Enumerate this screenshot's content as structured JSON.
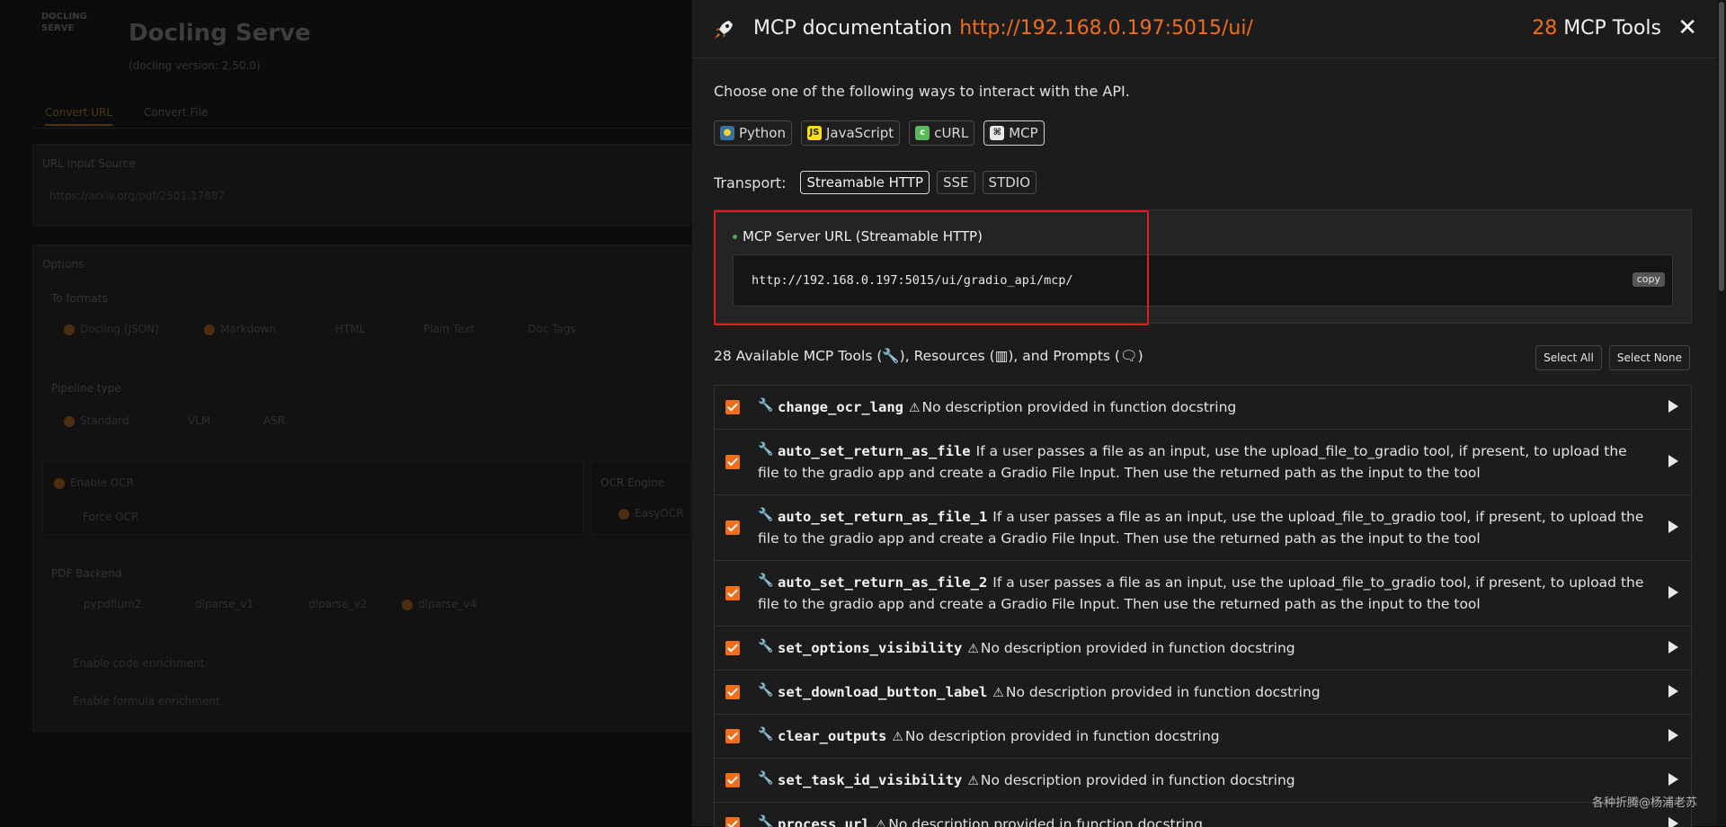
{
  "background_app": {
    "logo_lines": [
      "DOCLING",
      "SERVE"
    ],
    "title": "Docling Serve",
    "version": "(docling version: 2.50.0)",
    "tabs": [
      "Convert URL",
      "Convert File"
    ],
    "url_label": "URL Input Source",
    "url_placeholder": "https://arxiv.org/pdf/2501.17887",
    "options_label": "Options",
    "to_formats_label": "To formats",
    "to_formats": [
      "Docling (JSON)",
      "Markdown",
      "HTML",
      "Plain Text",
      "Doc Tags"
    ],
    "pipeline_label": "Pipeline type",
    "pipelines": [
      "Standard",
      "VLM",
      "ASR"
    ],
    "enable_ocr": "Enable OCR",
    "force_ocr": "Force OCR",
    "ocr_engine_label": "OCR Engine",
    "ocr_engine": "EasyOCR",
    "pdf_backend_label": "PDF Backend",
    "pdf_backends": [
      "pypdfium2",
      "dlparse_v1",
      "dlparse_v2",
      "dlparse_v4"
    ],
    "enrich_code": "Enable code enrichment",
    "enrich_formula": "Enable formula enrichment"
  },
  "modal": {
    "title": "MCP documentation",
    "url": "http://192.168.0.197:5015/ui/",
    "tools_count": "28",
    "tools_label": "MCP Tools",
    "close_symbol": "✕",
    "intro": "Choose one of the following ways to interact with the API.",
    "languages": [
      "Python",
      "JavaScript",
      "cURL",
      "MCP"
    ],
    "active_language": "MCP",
    "transport_label": "Transport:",
    "transports": [
      "Streamable HTTP",
      "SSE",
      "STDIO"
    ],
    "active_transport": "Streamable HTTP",
    "server_url_title": "MCP Server URL (Streamable HTTP)",
    "server_url": "http://192.168.0.197:5015/ui/gradio_api/mcp/",
    "copy_label": "copy",
    "available_text": "28 Available MCP Tools (🔧), Resources (▥), and Prompts (🗨)",
    "select_all": "Select All",
    "select_none": "Select None",
    "tools": [
      {
        "name": "change_ocr_lang",
        "warn": true,
        "description": "No description provided in function docstring"
      },
      {
        "name": "auto_set_return_as_file",
        "warn": false,
        "description": "If a user passes a file as an input, use the upload_file_to_gradio tool, if present, to upload the file to the gradio app and create a Gradio File Input. Then use the returned path as the input to the tool"
      },
      {
        "name": "auto_set_return_as_file_1",
        "warn": false,
        "description": "If a user passes a file as an input, use the upload_file_to_gradio tool, if present, to upload the file to the gradio app and create a Gradio File Input. Then use the returned path as the input to the tool"
      },
      {
        "name": "auto_set_return_as_file_2",
        "warn": false,
        "description": "If a user passes a file as an input, use the upload_file_to_gradio tool, if present, to upload the file to the gradio app and create a Gradio File Input. Then use the returned path as the input to the tool"
      },
      {
        "name": "set_options_visibility",
        "warn": true,
        "description": "No description provided in function docstring"
      },
      {
        "name": "set_download_button_label",
        "warn": true,
        "description": "No description provided in function docstring"
      },
      {
        "name": "clear_outputs",
        "warn": true,
        "description": "No description provided in function docstring"
      },
      {
        "name": "set_task_id_visibility",
        "warn": true,
        "description": "No description provided in function docstring"
      },
      {
        "name": "process_url",
        "warn": true,
        "description": "No description provided in function docstring"
      }
    ],
    "warn_symbol": "⚠",
    "wrench_symbol": "🔧"
  },
  "watermark": "各种折腾@杨浦老苏",
  "colors": {
    "accent": "#f06d19",
    "highlight": "#e01e1e",
    "check": "#f06d19"
  }
}
